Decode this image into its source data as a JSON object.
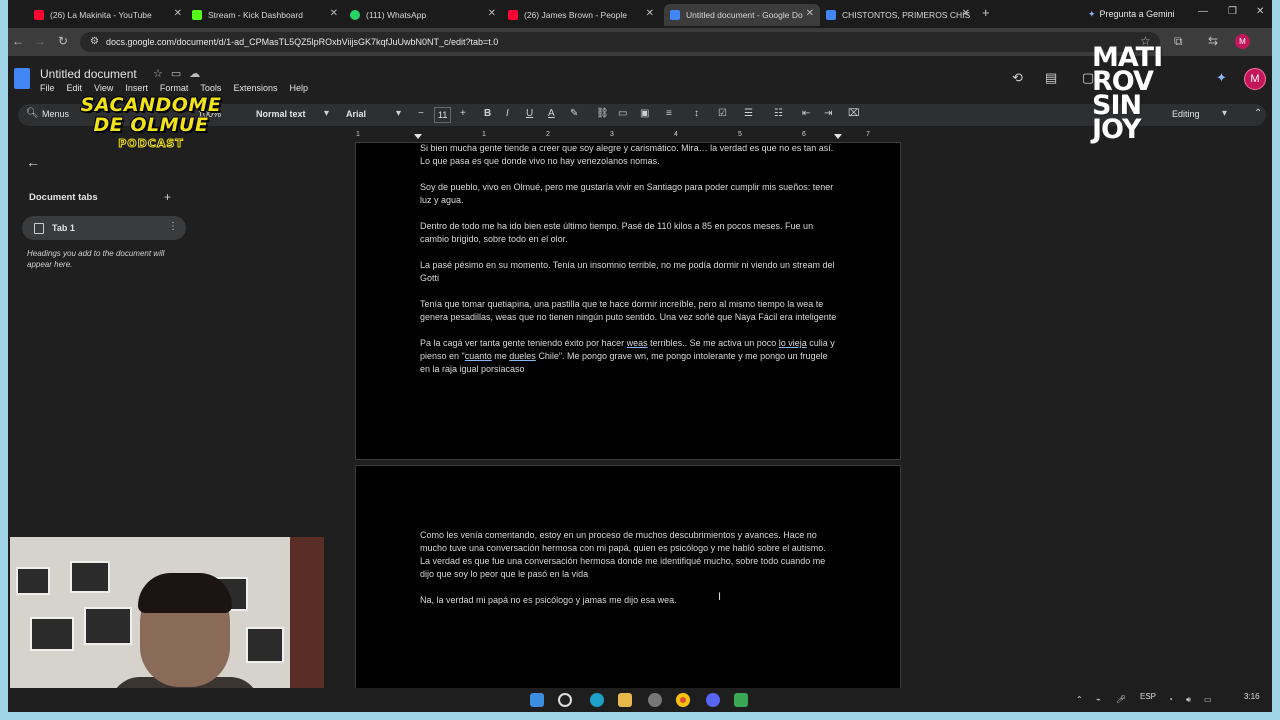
{
  "browser": {
    "tabs": [
      {
        "label": "(26) La Makinita - YouTube",
        "color": "#ff0033",
        "active": false
      },
      {
        "label": "Stream - Kick Dashboard",
        "color": "#53fc18",
        "active": false
      },
      {
        "label": "(111) WhatsApp",
        "color": "#25d366",
        "active": false
      },
      {
        "label": "(26) James Brown - People",
        "color": "#ff0033",
        "active": false
      },
      {
        "label": "Untitled document - Google Do",
        "color": "#4285f4",
        "active": true
      },
      {
        "label": "CHISTONTOS, PRIMEROS CHIS",
        "color": "#4285f4",
        "active": false
      }
    ],
    "gemini_button": "Pregunta a Gemini",
    "url": "docs.google.com/document/d/1-ad_CPMasTL5QZ5lpROxbViijsGK7kqfJuUwbN0NT_c/edit?tab=t.0",
    "profile_initial": "M"
  },
  "docs": {
    "title": "Untitled document",
    "menu": [
      "File",
      "Edit",
      "View",
      "Insert",
      "Format",
      "Tools",
      "Extensions",
      "Help"
    ],
    "avatar_initial": "M",
    "toolbar": {
      "menus_label": "Menus",
      "zoom": "100%",
      "style": "Normal text",
      "font": "Arial",
      "font_size": "11",
      "mode": "Editing"
    },
    "ruler_marks": [
      "1",
      "1",
      "2",
      "3",
      "4",
      "5",
      "6",
      "7"
    ]
  },
  "sidebar": {
    "title": "Document tabs",
    "tab_label": "Tab 1",
    "help_text": "Headings you add to the document will appear here."
  },
  "page1": {
    "paragraphs": [
      "Si bien mucha gente tiende a creer que soy alegre y carismático. Mira… la verdad es que no es tan así. Lo que pasa es que donde vivo no hay venezolanos nomas.",
      "Soy de pueblo, vivo en Olmué, pero me gustaría vivir en Santiago para poder cumplir mis sueños: tener luz y agua.",
      "Dentro de todo me ha ido bien este último tiempo. Pasé de 110 kilos a 85 en pocos meses. Fue un cambio brigido, sobre todo en el olor.",
      "La pasé pésimo en su momento. Tenía un insomnio terrible, no me podía dormir ni viendo un stream del Gotti",
      "Tenía que tomar quetiapina, una pastilla que te hace dormir increíble, pero al mismo tiempo la wea te genera pesadillas, weas que no tienen ningún puto sentido. Una vez soñé que Naya Fácil era inteligente"
    ],
    "last": {
      "a": "Pa la cagá ver tanta gente teniendo éxito por hacer ",
      "b": "weas",
      "c": " terribles.. Se me activa un poco ",
      "d": "lo vieja",
      "e": " culia y pienso en \"",
      "f": "cuanto",
      "g": " me ",
      "h": "dueles",
      "i": " Chile\". Me pongo grave wn, me pongo intolerante y me pongo un frugele en la raja igual porsiacaso"
    }
  },
  "page2": {
    "paragraphs": [
      "Como les venía comentando, estoy en un proceso de muchos descubrimientos y avances. Hace no mucho tuve una conversación hermosa con mi papá, quien es psicólogo y me habló sobre el autismo. La verdad es que fue una conversación hermosa donde me identifiqué mucho, sobre todo cuando me dijo que soy lo peor que le pasó en la vida",
      "Na, la verdad mi papá no es psicólogo y jamas me dijo esa wea."
    ]
  },
  "overlays": {
    "logo_left": [
      "SACANDOME",
      "DE OLMUE",
      "PODCAST"
    ],
    "logo_right": [
      "MATI",
      "ROV",
      "SIN",
      "JOY"
    ]
  },
  "taskbar": {
    "lang": "ESP",
    "lang2": "ES",
    "time": "3:16"
  }
}
